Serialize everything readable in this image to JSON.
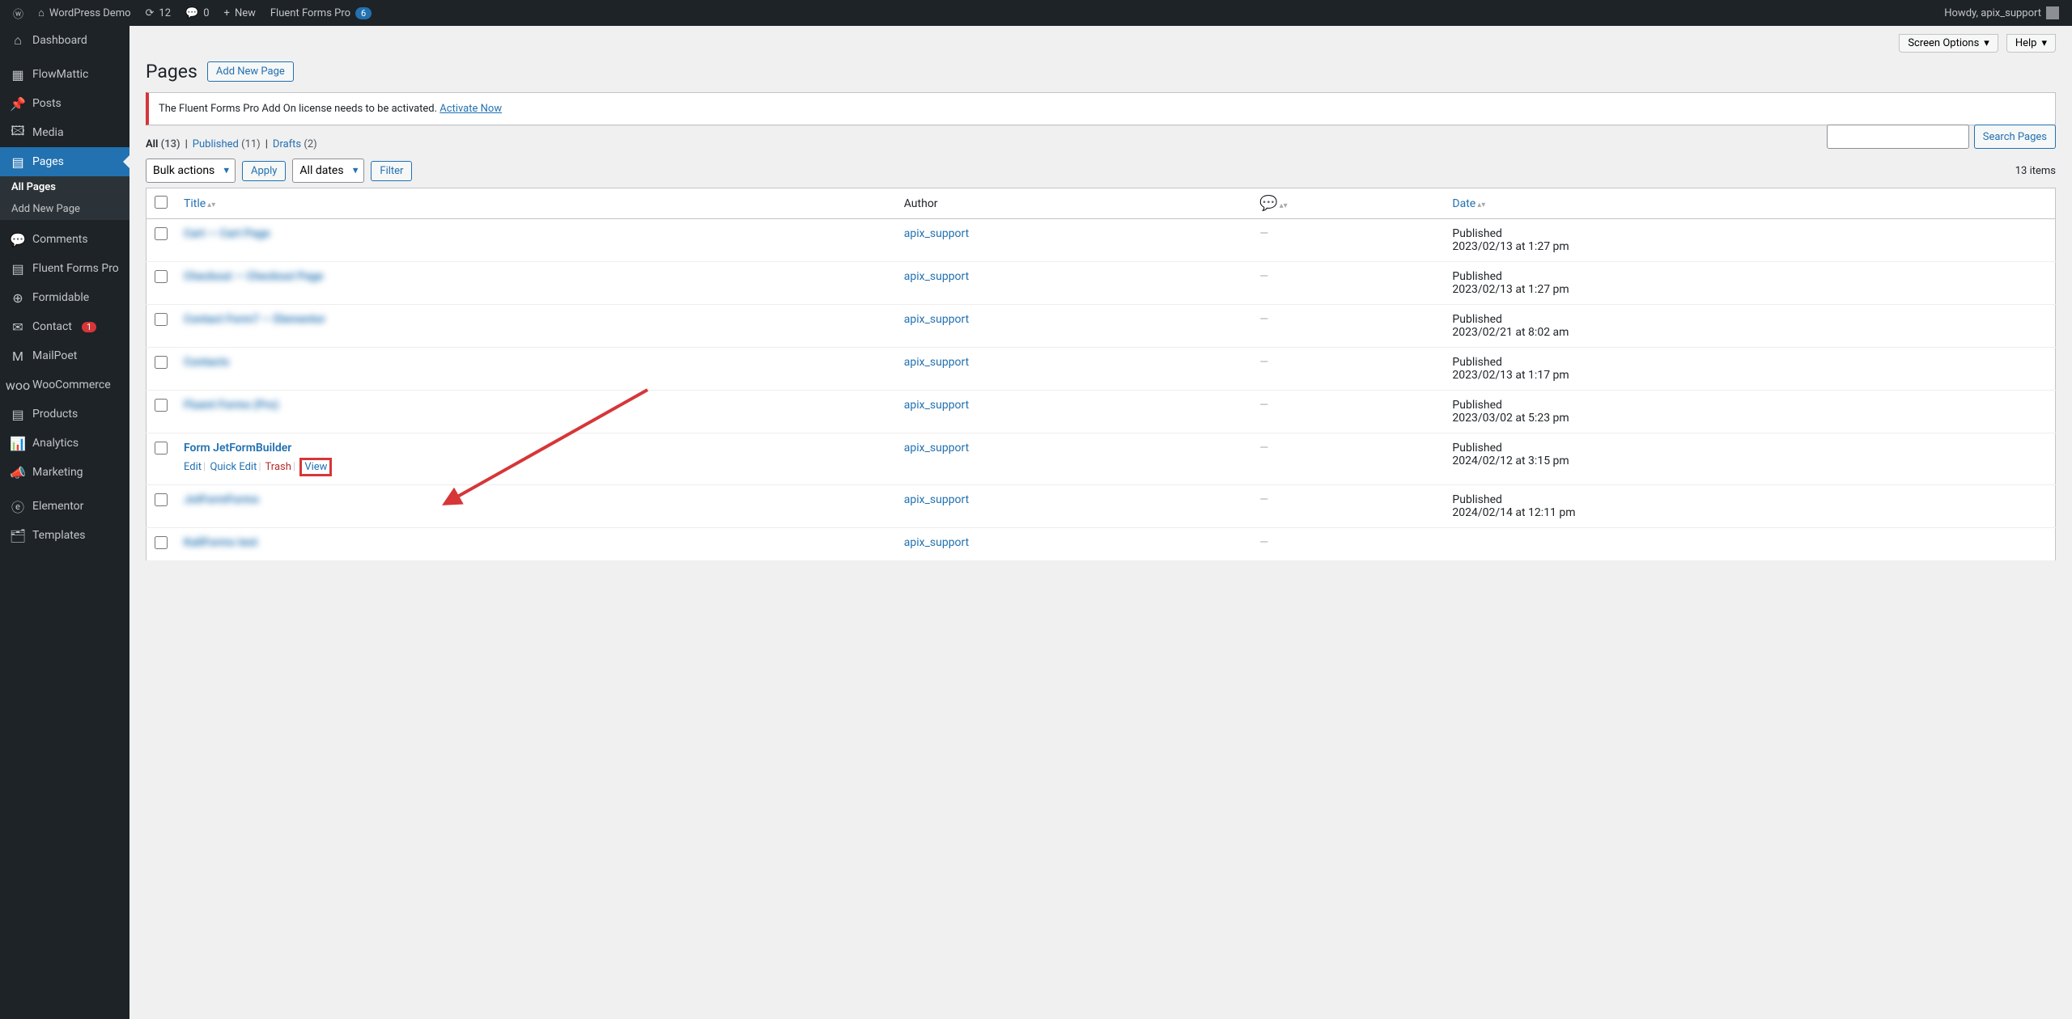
{
  "admin_bar": {
    "site_name": "WordPress Demo",
    "updates": "12",
    "comments": "0",
    "new": "New",
    "fluent_forms": "Fluent Forms Pro",
    "fluent_badge": "6",
    "howdy": "Howdy, apix_support"
  },
  "sidebar": {
    "items": [
      {
        "label": "Dashboard",
        "icon": "⌂"
      },
      {
        "label": "FlowMattic",
        "icon": "▦"
      },
      {
        "label": "Posts",
        "icon": "📌"
      },
      {
        "label": "Media",
        "icon": "🖾"
      },
      {
        "label": "Pages",
        "icon": "▤",
        "active": true
      },
      {
        "label": "Comments",
        "icon": "💬"
      },
      {
        "label": "Fluent Forms Pro",
        "icon": "▤"
      },
      {
        "label": "Formidable",
        "icon": "⊕"
      },
      {
        "label": "Contact",
        "icon": "✉",
        "badge": "1"
      },
      {
        "label": "MailPoet",
        "icon": "M"
      },
      {
        "label": "WooCommerce",
        "icon": "woo"
      },
      {
        "label": "Products",
        "icon": "▤"
      },
      {
        "label": "Analytics",
        "icon": "📊"
      },
      {
        "label": "Marketing",
        "icon": "📣"
      },
      {
        "label": "Elementor",
        "icon": "ⓔ"
      },
      {
        "label": "Templates",
        "icon": "🗂"
      }
    ],
    "submenu": [
      {
        "label": "All Pages",
        "active": true
      },
      {
        "label": "Add New Page"
      }
    ]
  },
  "top_options": {
    "screen_options": "Screen Options",
    "help": "Help"
  },
  "header": {
    "title": "Pages",
    "add_new": "Add New Page"
  },
  "notice": {
    "text": "The Fluent Forms Pro Add On license needs to be activated. ",
    "link": "Activate Now"
  },
  "subsubsub": {
    "all": "All",
    "all_count": "(13)",
    "published": "Published",
    "published_count": "(11)",
    "drafts": "Drafts",
    "drafts_count": "(2)"
  },
  "tablenav": {
    "bulk_actions": "Bulk actions",
    "apply": "Apply",
    "all_dates": "All dates",
    "filter": "Filter",
    "items_count": "13 items"
  },
  "search": {
    "button": "Search Pages"
  },
  "table": {
    "col_title": "Title",
    "col_author": "Author",
    "col_date": "Date"
  },
  "rows": [
    {
      "title": "Cart — Cart Page",
      "author": "apix_support",
      "comments": "—",
      "status": "Published",
      "date": "2023/02/13 at 1:27 pm",
      "blur": true
    },
    {
      "title": "Checkout — Checkout Page",
      "author": "apix_support",
      "comments": "—",
      "status": "Published",
      "date": "2023/02/13 at 1:27 pm",
      "blur": true
    },
    {
      "title": "Contact Form7 — Elementor",
      "author": "apix_support",
      "comments": "—",
      "status": "Published",
      "date": "2023/02/21 at 8:02 am",
      "blur": true
    },
    {
      "title": "Contacts",
      "author": "apix_support",
      "comments": "—",
      "status": "Published",
      "date": "2023/02/13 at 1:17 pm",
      "blur": true
    },
    {
      "title": "Fluent Forms (Pro)",
      "author": "apix_support",
      "comments": "—",
      "status": "Published",
      "date": "2023/03/02 at 5:23 pm",
      "blur": true
    },
    {
      "title": "Form JetFormBuilder",
      "author": "apix_support",
      "comments": "—",
      "status": "Published",
      "date": "2024/02/12 at 3:15 pm",
      "blur": false,
      "actions": true
    },
    {
      "title": "JotFormForms",
      "author": "apix_support",
      "comments": "—",
      "status": "Published",
      "date": "2024/02/14 at 12:11 pm",
      "blur": true
    },
    {
      "title": "KaliForms test",
      "author": "apix_support",
      "comments": "—",
      "status": "",
      "date": "",
      "blur": true
    }
  ],
  "row_actions": {
    "edit": "Edit",
    "quick_edit": "Quick Edit",
    "trash": "Trash",
    "view": "View"
  }
}
